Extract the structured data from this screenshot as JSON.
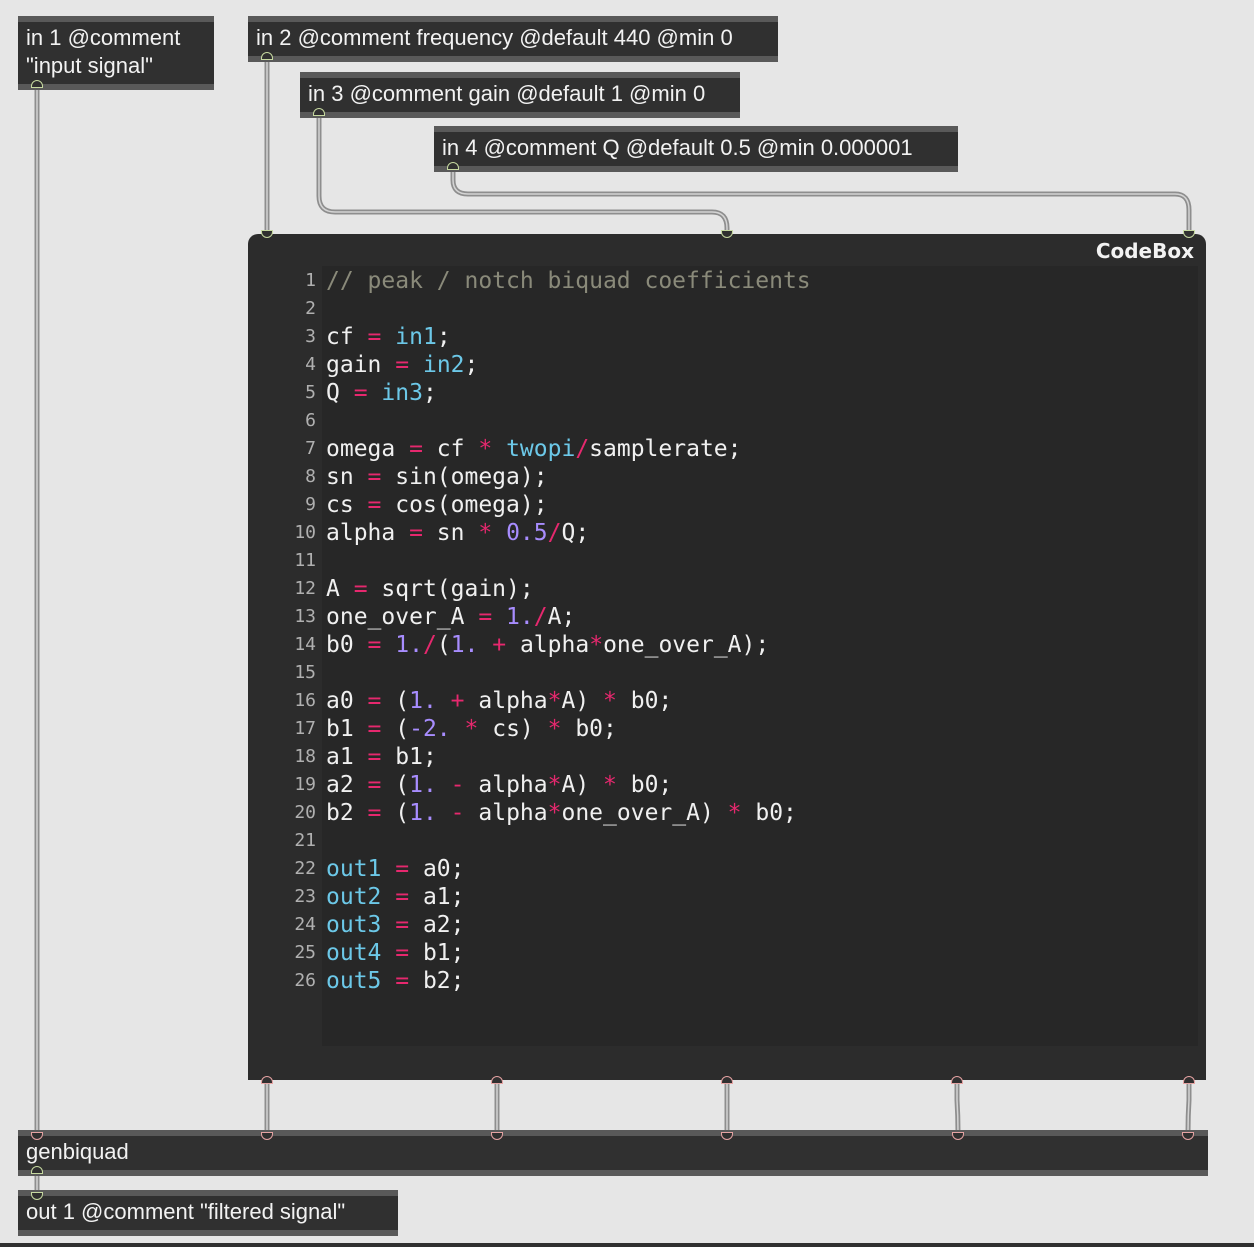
{
  "objects": {
    "in1": "in 1 @comment\n\"input signal\"",
    "in2": "in 2 @comment frequency @default 440 @min 0",
    "in3": "in 3 @comment gain @default 1 @min 0",
    "in4": "in 4 @comment Q @default 0.5 @min 0.000001",
    "genbiquad": "genbiquad",
    "out1": "out 1 @comment \"filtered signal\""
  },
  "codebox": {
    "title": "CodeBox",
    "line_numbers": [
      "1",
      "2",
      "3",
      "4",
      "5",
      "6",
      "7",
      "8",
      "9",
      "10",
      "11",
      "12",
      "13",
      "14",
      "15",
      "16",
      "17",
      "18",
      "19",
      "20",
      "21",
      "22",
      "23",
      "24",
      "25",
      "26"
    ],
    "lines": [
      [
        {
          "t": "// peak / notch biquad coefficients",
          "k": "comment"
        }
      ],
      [],
      [
        {
          "t": "cf ",
          "k": "plain"
        },
        {
          "t": "=",
          "k": "op"
        },
        {
          "t": " ",
          "k": "plain"
        },
        {
          "t": "in1",
          "k": "builtin"
        },
        {
          "t": ";",
          "k": "plain"
        }
      ],
      [
        {
          "t": "gain ",
          "k": "plain"
        },
        {
          "t": "=",
          "k": "op"
        },
        {
          "t": " ",
          "k": "plain"
        },
        {
          "t": "in2",
          "k": "builtin"
        },
        {
          "t": ";",
          "k": "plain"
        }
      ],
      [
        {
          "t": "Q ",
          "k": "plain"
        },
        {
          "t": "=",
          "k": "op"
        },
        {
          "t": " ",
          "k": "plain"
        },
        {
          "t": "in3",
          "k": "builtin"
        },
        {
          "t": ";",
          "k": "plain"
        }
      ],
      [],
      [
        {
          "t": "omega ",
          "k": "plain"
        },
        {
          "t": "=",
          "k": "op"
        },
        {
          "t": " cf ",
          "k": "plain"
        },
        {
          "t": "*",
          "k": "op"
        },
        {
          "t": " ",
          "k": "plain"
        },
        {
          "t": "twopi",
          "k": "builtin"
        },
        {
          "t": "/",
          "k": "op"
        },
        {
          "t": "samplerate;",
          "k": "plain"
        }
      ],
      [
        {
          "t": "sn ",
          "k": "plain"
        },
        {
          "t": "=",
          "k": "op"
        },
        {
          "t": " sin(omega);",
          "k": "plain"
        }
      ],
      [
        {
          "t": "cs ",
          "k": "plain"
        },
        {
          "t": "=",
          "k": "op"
        },
        {
          "t": " cos(omega);",
          "k": "plain"
        }
      ],
      [
        {
          "t": "alpha ",
          "k": "plain"
        },
        {
          "t": "=",
          "k": "op"
        },
        {
          "t": " sn ",
          "k": "plain"
        },
        {
          "t": "*",
          "k": "op"
        },
        {
          "t": " ",
          "k": "plain"
        },
        {
          "t": "0.5",
          "k": "num"
        },
        {
          "t": "/",
          "k": "op"
        },
        {
          "t": "Q;",
          "k": "plain"
        }
      ],
      [],
      [
        {
          "t": "A ",
          "k": "plain"
        },
        {
          "t": "=",
          "k": "op"
        },
        {
          "t": " sqrt(gain);",
          "k": "plain"
        }
      ],
      [
        {
          "t": "one_over_A ",
          "k": "plain"
        },
        {
          "t": "=",
          "k": "op"
        },
        {
          "t": " ",
          "k": "plain"
        },
        {
          "t": "1.",
          "k": "num"
        },
        {
          "t": "/",
          "k": "op"
        },
        {
          "t": "A;",
          "k": "plain"
        }
      ],
      [
        {
          "t": "b0 ",
          "k": "plain"
        },
        {
          "t": "=",
          "k": "op"
        },
        {
          "t": " ",
          "k": "plain"
        },
        {
          "t": "1.",
          "k": "num"
        },
        {
          "t": "/",
          "k": "op"
        },
        {
          "t": "(",
          "k": "plain"
        },
        {
          "t": "1.",
          "k": "num"
        },
        {
          "t": " ",
          "k": "plain"
        },
        {
          "t": "+",
          "k": "op"
        },
        {
          "t": " alpha",
          "k": "plain"
        },
        {
          "t": "*",
          "k": "op"
        },
        {
          "t": "one_over_A);",
          "k": "plain"
        }
      ],
      [],
      [
        {
          "t": "a0 ",
          "k": "plain"
        },
        {
          "t": "=",
          "k": "op"
        },
        {
          "t": " (",
          "k": "plain"
        },
        {
          "t": "1.",
          "k": "num"
        },
        {
          "t": " ",
          "k": "plain"
        },
        {
          "t": "+",
          "k": "op"
        },
        {
          "t": " alpha",
          "k": "plain"
        },
        {
          "t": "*",
          "k": "op"
        },
        {
          "t": "A) ",
          "k": "plain"
        },
        {
          "t": "*",
          "k": "op"
        },
        {
          "t": " b0;",
          "k": "plain"
        }
      ],
      [
        {
          "t": "b1 ",
          "k": "plain"
        },
        {
          "t": "=",
          "k": "op"
        },
        {
          "t": " (",
          "k": "plain"
        },
        {
          "t": "-2.",
          "k": "num"
        },
        {
          "t": " ",
          "k": "plain"
        },
        {
          "t": "*",
          "k": "op"
        },
        {
          "t": " cs) ",
          "k": "plain"
        },
        {
          "t": "*",
          "k": "op"
        },
        {
          "t": " b0;",
          "k": "plain"
        }
      ],
      [
        {
          "t": "a1 ",
          "k": "plain"
        },
        {
          "t": "=",
          "k": "op"
        },
        {
          "t": " b1;",
          "k": "plain"
        }
      ],
      [
        {
          "t": "a2 ",
          "k": "plain"
        },
        {
          "t": "=",
          "k": "op"
        },
        {
          "t": " (",
          "k": "plain"
        },
        {
          "t": "1.",
          "k": "num"
        },
        {
          "t": " ",
          "k": "plain"
        },
        {
          "t": "-",
          "k": "op"
        },
        {
          "t": " alpha",
          "k": "plain"
        },
        {
          "t": "*",
          "k": "op"
        },
        {
          "t": "A) ",
          "k": "plain"
        },
        {
          "t": "*",
          "k": "op"
        },
        {
          "t": " b0;",
          "k": "plain"
        }
      ],
      [
        {
          "t": "b2 ",
          "k": "plain"
        },
        {
          "t": "=",
          "k": "op"
        },
        {
          "t": " (",
          "k": "plain"
        },
        {
          "t": "1.",
          "k": "num"
        },
        {
          "t": " ",
          "k": "plain"
        },
        {
          "t": "-",
          "k": "op"
        },
        {
          "t": " alpha",
          "k": "plain"
        },
        {
          "t": "*",
          "k": "op"
        },
        {
          "t": "one_over_A) ",
          "k": "plain"
        },
        {
          "t": "*",
          "k": "op"
        },
        {
          "t": " b0;",
          "k": "plain"
        }
      ],
      [],
      [
        {
          "t": "out1",
          "k": "builtin"
        },
        {
          "t": " ",
          "k": "plain"
        },
        {
          "t": "=",
          "k": "op"
        },
        {
          "t": " a0;",
          "k": "plain"
        }
      ],
      [
        {
          "t": "out2",
          "k": "builtin"
        },
        {
          "t": " ",
          "k": "plain"
        },
        {
          "t": "=",
          "k": "op"
        },
        {
          "t": " a1;",
          "k": "plain"
        }
      ],
      [
        {
          "t": "out3",
          "k": "builtin"
        },
        {
          "t": " ",
          "k": "plain"
        },
        {
          "t": "=",
          "k": "op"
        },
        {
          "t": " a2;",
          "k": "plain"
        }
      ],
      [
        {
          "t": "out4",
          "k": "builtin"
        },
        {
          "t": " ",
          "k": "plain"
        },
        {
          "t": "=",
          "k": "op"
        },
        {
          "t": " b1;",
          "k": "plain"
        }
      ],
      [
        {
          "t": "out5",
          "k": "builtin"
        },
        {
          "t": " ",
          "k": "plain"
        },
        {
          "t": "=",
          "k": "op"
        },
        {
          "t": " b2;",
          "k": "plain"
        }
      ]
    ]
  },
  "colors": {
    "background": "#e6e6e6",
    "object_fill": "#303030",
    "object_border": "#595959",
    "cord": "#a8a8a8",
    "code_operator": "#e6286e",
    "code_number": "#a88dff",
    "code_builtin": "#6cc8e8",
    "code_comment": "#8a8a7a"
  }
}
